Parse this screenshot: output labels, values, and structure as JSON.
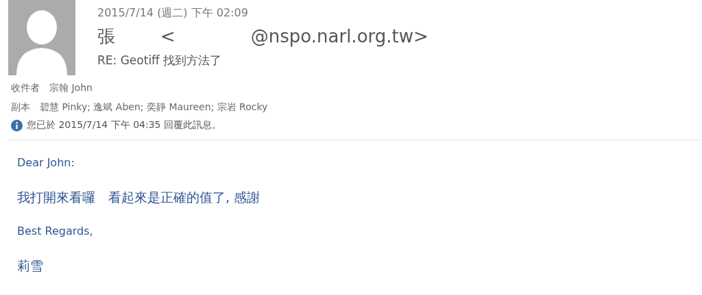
{
  "header": {
    "date": "2015/7/14 (週二) 下午 02:09",
    "sender_name": "張",
    "sender_open": "<",
    "sender_domain": "@nspo.narl.org.tw>",
    "subject": "RE: Geotiff 找到方法了"
  },
  "recipients": [
    {
      "label": "收件者",
      "value": "宗翰 John"
    },
    {
      "label": "副本",
      "value": "碧慧 Pinky; 逸斌 Aben; 奕靜 Maureen; 宗岩 Rocky"
    }
  ],
  "info": "您已於 2015/7/14 下午 04:35 回覆此訊息。",
  "body": [
    {
      "kind": "latin",
      "text": "Dear John:"
    },
    {
      "kind": "cjk",
      "text": "我打開來看囉　看起來是正確的值了, 感謝"
    },
    {
      "kind": "latin",
      "text": "Best Regards,"
    },
    {
      "kind": "cjk",
      "text": "莉雪"
    }
  ]
}
